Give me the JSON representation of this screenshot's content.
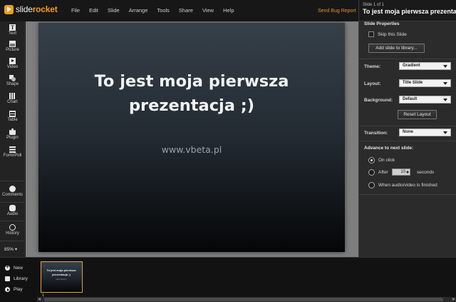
{
  "app": {
    "name_part1": "slide",
    "name_part2": "rocket",
    "bug_report": "Send Bug Report"
  },
  "menu": [
    "File",
    "Edit",
    "Slide",
    "Arrange",
    "Tools",
    "Share",
    "View",
    "Help"
  ],
  "toolbar": {
    "tools": [
      "Text",
      "Picture",
      "Video",
      "Shape",
      "Chart",
      "Table",
      "Plugin",
      "Form/Poll"
    ],
    "comments": "Comments",
    "audio": "Audio",
    "history": "History",
    "zoom": "85%"
  },
  "slide": {
    "title_line1": "To jest moja pierwsza",
    "title_line2": "prezentacja ;)",
    "subtitle": "www.vbeta.pl"
  },
  "panel": {
    "slide_count": "Slide 1 of 1",
    "slide_name": "To jest moja pierwsza prezentacja ;)",
    "properties_title": "Slide Properties",
    "skip_label": "Skip this Slide",
    "add_library": "Add slide to library...",
    "theme_label": "Theme:",
    "theme_value": "Gradient",
    "layout_label": "Layout:",
    "layout_value": "Title Slide",
    "background_label": "Background:",
    "background_value": "Default",
    "reset_layout": "Reset Layout",
    "transition_label": "Transition:",
    "transition_value": "None",
    "advance_title": "Advance to next slide:",
    "on_click": "On click",
    "after_label": "After",
    "after_value": "10",
    "seconds": "seconds",
    "when_finished": "When audio/video is finished"
  },
  "bottom": {
    "new": "New",
    "library": "Library",
    "play": "Play",
    "thumb_title_line1": "To jest moja pierwsza",
    "thumb_title_line2": "prezentacja ;)",
    "thumb_subtitle": "www.vbeta.pl",
    "thumb_number": "1"
  }
}
